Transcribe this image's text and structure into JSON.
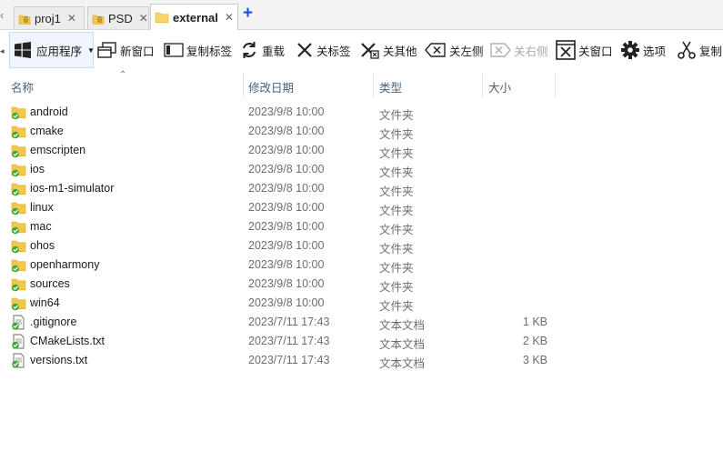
{
  "tabs": [
    {
      "label": "proj1",
      "locked": true,
      "active": false
    },
    {
      "label": "PSD",
      "locked": true,
      "active": false
    },
    {
      "label": "external",
      "locked": false,
      "active": true
    }
  ],
  "tab_add_label": "+",
  "toolbar": {
    "apps_label": "应用程序",
    "new_window_label": "新窗口",
    "copy_tab_label": "复制标签",
    "reload_label": "重载",
    "close_tab_label": "关标签",
    "close_others_label": "关其他",
    "close_left_label": "关左侧",
    "close_right_label": "关右侧",
    "close_window_label": "关窗口",
    "options_label": "选项",
    "copy_label": "复制"
  },
  "columns": {
    "name": "名称",
    "modified": "修改日期",
    "type": "类型",
    "size": "大小"
  },
  "files": [
    {
      "name": "android",
      "date": "2023/9/8 10:00",
      "type": "文件夹",
      "size": "",
      "kind": "folder"
    },
    {
      "name": "cmake",
      "date": "2023/9/8 10:00",
      "type": "文件夹",
      "size": "",
      "kind": "folder"
    },
    {
      "name": "emscripten",
      "date": "2023/9/8 10:00",
      "type": "文件夹",
      "size": "",
      "kind": "folder"
    },
    {
      "name": "ios",
      "date": "2023/9/8 10:00",
      "type": "文件夹",
      "size": "",
      "kind": "folder"
    },
    {
      "name": "ios-m1-simulator",
      "date": "2023/9/8 10:00",
      "type": "文件夹",
      "size": "",
      "kind": "folder"
    },
    {
      "name": "linux",
      "date": "2023/9/8 10:00",
      "type": "文件夹",
      "size": "",
      "kind": "folder"
    },
    {
      "name": "mac",
      "date": "2023/9/8 10:00",
      "type": "文件夹",
      "size": "",
      "kind": "folder"
    },
    {
      "name": "ohos",
      "date": "2023/9/8 10:00",
      "type": "文件夹",
      "size": "",
      "kind": "folder"
    },
    {
      "name": "openharmony",
      "date": "2023/9/8 10:00",
      "type": "文件夹",
      "size": "",
      "kind": "folder"
    },
    {
      "name": "sources",
      "date": "2023/9/8 10:00",
      "type": "文件夹",
      "size": "",
      "kind": "folder"
    },
    {
      "name": "win64",
      "date": "2023/9/8 10:00",
      "type": "文件夹",
      "size": "",
      "kind": "folder"
    },
    {
      "name": ".gitignore",
      "date": "2023/7/11 17:43",
      "type": "文本文档",
      "size": "1 KB",
      "kind": "file"
    },
    {
      "name": "CMakeLists.txt",
      "date": "2023/7/11 17:43",
      "type": "文本文档",
      "size": "2 KB",
      "kind": "file"
    },
    {
      "name": "versions.txt",
      "date": "2023/7/11 17:43",
      "type": "文本文档",
      "size": "3 KB",
      "kind": "file"
    }
  ],
  "colors": {
    "folder": "#f3c84a",
    "sync_badge": "#3aa935",
    "tab_add": "#1f4fd6",
    "header_text": "#4c607a"
  }
}
